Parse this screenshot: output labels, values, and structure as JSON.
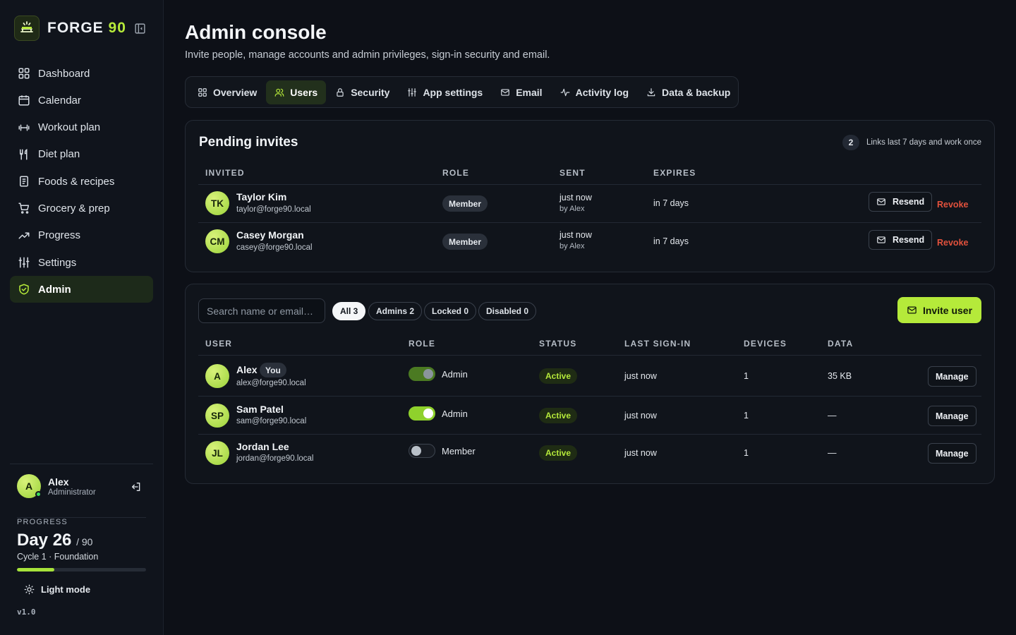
{
  "brand": {
    "name": "FORGE",
    "number": "90"
  },
  "sidebar": {
    "items": [
      {
        "label": "Dashboard",
        "icon": "grid-icon"
      },
      {
        "label": "Calendar",
        "icon": "calendar-icon"
      },
      {
        "label": "Workout plan",
        "icon": "dumbbell-icon"
      },
      {
        "label": "Diet plan",
        "icon": "utensils-icon"
      },
      {
        "label": "Foods & recipes",
        "icon": "book-icon"
      },
      {
        "label": "Grocery & prep",
        "icon": "cart-icon"
      },
      {
        "label": "Progress",
        "icon": "trending-up-icon"
      },
      {
        "label": "Settings",
        "icon": "sliders-icon"
      },
      {
        "label": "Admin",
        "icon": "shield-check-icon",
        "active": true
      }
    ]
  },
  "current_user": {
    "initial": "A",
    "name": "Alex",
    "role": "Administrator"
  },
  "progress": {
    "label": "PROGRESS",
    "day": "Day 26",
    "of": "/ 90",
    "cycle": "Cycle 1 · Foundation",
    "fraction": 0.289
  },
  "theme_toggle": "Light mode",
  "version": "v1.0",
  "page": {
    "title": "Admin console",
    "subtitle": "Invite people, manage accounts and admin privileges, sign-in security and email."
  },
  "tabs": [
    {
      "label": "Overview",
      "icon": "grid-icon"
    },
    {
      "label": "Users",
      "icon": "users-icon",
      "active": true
    },
    {
      "label": "Security",
      "icon": "lock-icon"
    },
    {
      "label": "App settings",
      "icon": "sliders-icon"
    },
    {
      "label": "Email",
      "icon": "mail-icon"
    },
    {
      "label": "Activity log",
      "icon": "activity-icon"
    },
    {
      "label": "Data & backup",
      "icon": "download-icon"
    }
  ],
  "pending": {
    "title": "Pending invites",
    "count": "2",
    "note": "Links last 7 days and work once",
    "columns": [
      "INVITED",
      "ROLE",
      "SENT",
      "EXPIRES"
    ],
    "rows": [
      {
        "initials": "TK",
        "name": "Taylor Kim",
        "email": "taylor@forge90.local",
        "role": "Member",
        "sent": "just now",
        "sent_by": "by Alex",
        "expires": "in 7 days",
        "resend": "Resend",
        "revoke": "Revoke"
      },
      {
        "initials": "CM",
        "name": "Casey Morgan",
        "email": "casey@forge90.local",
        "role": "Member",
        "sent": "just now",
        "sent_by": "by Alex",
        "expires": "in 7 days",
        "resend": "Resend",
        "revoke": "Revoke"
      }
    ]
  },
  "users": {
    "search_placeholder": "Search name or email…",
    "filters": [
      {
        "label": "All 3",
        "active": true
      },
      {
        "label": "Admins 2"
      },
      {
        "label": "Locked 0"
      },
      {
        "label": "Disabled 0"
      }
    ],
    "invite_label": "Invite user",
    "columns": [
      "USER",
      "ROLE",
      "STATUS",
      "LAST SIGN-IN",
      "DEVICES",
      "DATA"
    ],
    "rows": [
      {
        "initials": "A",
        "name": "Alex",
        "badge": "You",
        "email": "alex@forge90.local",
        "admin": true,
        "locked": true,
        "role": "Admin",
        "status": "Active",
        "last_sign_in": "just now",
        "devices": "1",
        "data": "35 KB",
        "manage": "Manage"
      },
      {
        "initials": "SP",
        "name": "Sam Patel",
        "email": "sam@forge90.local",
        "admin": true,
        "role": "Admin",
        "status": "Active",
        "last_sign_in": "just now",
        "devices": "1",
        "data": "—",
        "manage": "Manage"
      },
      {
        "initials": "JL",
        "name": "Jordan Lee",
        "email": "jordan@forge90.local",
        "admin": false,
        "role": "Member",
        "status": "Active",
        "last_sign_in": "just now",
        "devices": "1",
        "data": "—",
        "manage": "Manage"
      }
    ]
  },
  "colors": {
    "accent": "#b5ea3a",
    "danger": "#e2513c",
    "background": "#0d1017"
  }
}
